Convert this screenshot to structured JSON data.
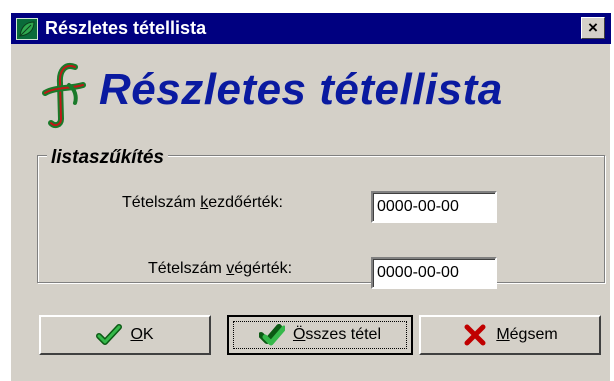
{
  "window": {
    "title": "Részletes tétellista",
    "close_label": "×"
  },
  "header": {
    "heading": "Részletes tétellista"
  },
  "filter": {
    "group_title": "listaszűkítés",
    "start_label_prefix": "Tételszám ",
    "start_label_mnemonic": "k",
    "start_label_suffix": "ezdőérték:",
    "start_value": "0000-00-00",
    "end_label_prefix": "Tételszám ",
    "end_label_mnemonic": "v",
    "end_label_suffix": "égérték:",
    "end_value": "0000-00-00"
  },
  "buttons": {
    "ok_mnemonic": "O",
    "ok_rest": "K",
    "all_mnemonic": "Ö",
    "all_rest": "sszes tétel",
    "cancel_mnemonic": "M",
    "cancel_rest": "égsem"
  },
  "icons": {
    "title": "leaf-icon",
    "logo": "f-logo-icon",
    "ok": "checkmark-icon",
    "all": "double-checkmark-icon",
    "cancel": "red-x-icon"
  },
  "colors": {
    "titlebar": "#000080",
    "heading": "#0a1aa0",
    "check": "#1a9a2a",
    "cancel_x": "#c00000",
    "face": "#d4d0c8"
  }
}
